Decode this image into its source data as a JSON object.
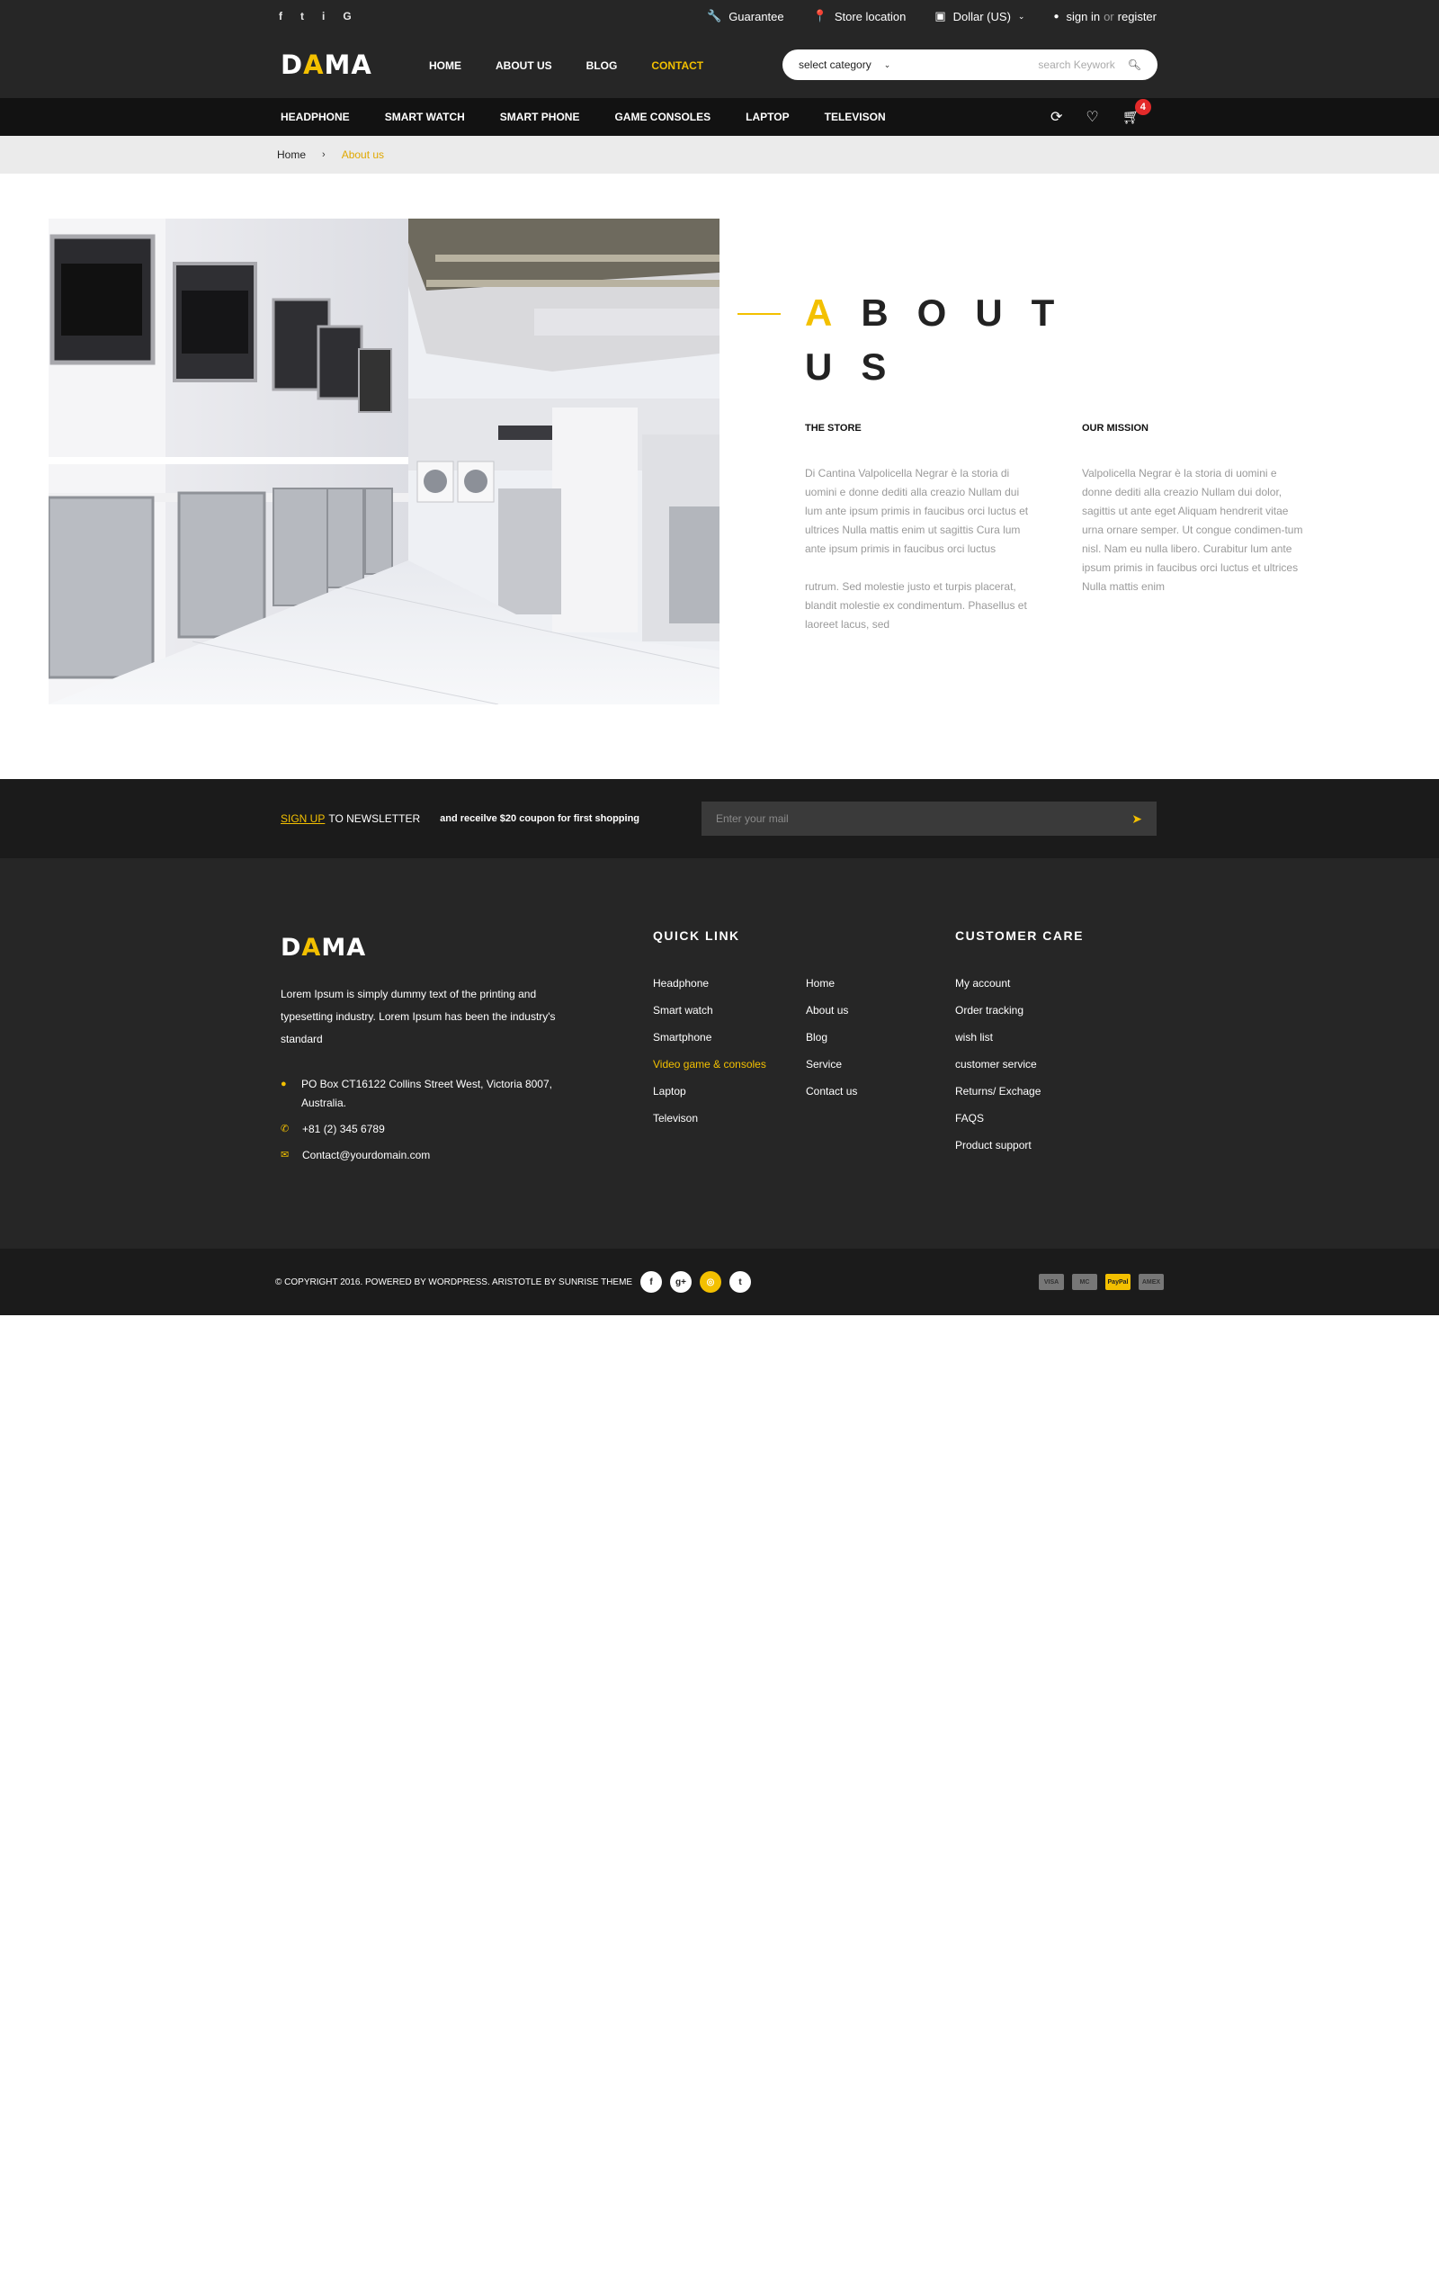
{
  "topbar": {
    "social": [
      "f",
      "t",
      "i",
      "G"
    ],
    "guarantee": "Guarantee",
    "store_location": "Store location",
    "currency": "Dollar (US)",
    "sign_in": "sign in",
    "or": "or",
    "register": "register"
  },
  "header": {
    "logo_pre": "D",
    "logo_accent": "A",
    "logo_post": "MA",
    "nav": [
      "HOME",
      "ABOUT US",
      "BLOG",
      "CONTACT"
    ],
    "search": {
      "category": "select category",
      "placeholder": "search Keywork"
    }
  },
  "categories": [
    "HEADPHONE",
    "SMART WATCH",
    "SMART PHONE",
    "GAME CONSOLES",
    "LAPTOP",
    "TELEVISON"
  ],
  "cart_count": "4",
  "breadcrumb": {
    "home": "Home",
    "sep": "›",
    "current": "About us"
  },
  "about": {
    "title_first": "A",
    "title_rest": "BOUT US",
    "store": {
      "heading": "THE STORE",
      "p1": "Di Cantina Valpolicella Negrar è la storia di uomini e donne dediti alla creazio Nullam dui lum ante ipsum primis in faucibus orci luctus et ultrices Nulla mattis enim ut sagittis Cura lum ante ipsum primis in faucibus orci luctus",
      "p2": "rutrum. Sed molestie justo et turpis placerat, blandit molestie ex condimentum. Phasellus et laoreet lacus, sed"
    },
    "mission": {
      "heading": "OUR MISSION",
      "p1": "Valpolicella Negrar è la storia di uomini e donne dediti alla creazio Nullam dui dolor, sagittis ut ante eget Aliquam hendrerit vitae urna ornare semper. Ut congue condimen-tum nisl. Nam eu nulla libero. Curabitur lum ante ipsum primis in faucibus orci luctus et ultrices Nulla mattis enim"
    }
  },
  "newsletter": {
    "signup": "SIGN UP",
    "to": "TO NEWSLETTER",
    "offer": "and receilve $20 coupon for first shopping",
    "placeholder": "Enter your mail"
  },
  "footer": {
    "description": "Lorem Ipsum is simply dummy text of the printing and typesetting industry. Lorem Ipsum has been the industry's standard",
    "address": "PO Box CT16122 Collins Street West, Victoria 8007, Australia.",
    "phone": "+81 (2) 345 6789",
    "email": "Contact@yourdomain.com",
    "quick_link_heading": "QUICK LINK",
    "quick_links_a": [
      "Headphone",
      "Smart watch",
      "Smartphone",
      "Video game & consoles",
      "Laptop",
      "Televison"
    ],
    "quick_links_b": [
      "Home",
      "About us",
      "Blog",
      "Service",
      "Contact us"
    ],
    "customer_care_heading": "CUSTOMER CARE",
    "customer_care": [
      "My account",
      "Order tracking",
      "wish list",
      "customer service",
      "Returns/ Exchage",
      "FAQS",
      "Product support"
    ]
  },
  "bottom": {
    "copyright": "© COPYRIGHT 2016. POWERED BY WORDPRESS. ARISTOTLE  BY SUNRISE THEME",
    "social": [
      "f",
      "g+",
      "◎",
      "t"
    ],
    "payments": [
      "VISA",
      "MC",
      "PayPal",
      "AMEX"
    ]
  },
  "colors": {
    "accent": "#f3c000",
    "dark": "#262626",
    "badge": "#e32a2a"
  }
}
